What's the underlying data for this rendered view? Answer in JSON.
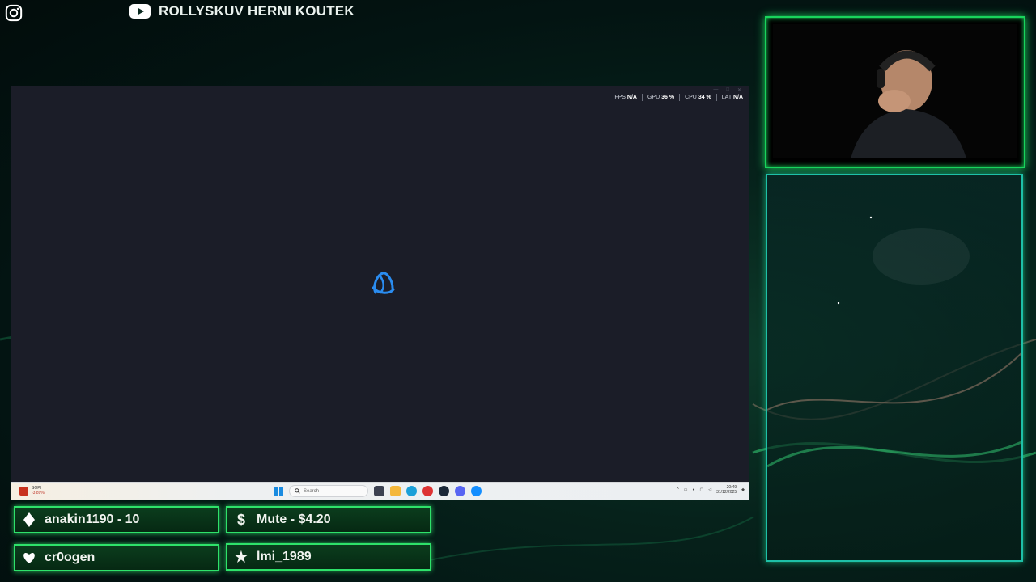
{
  "channel": {
    "name": "ROLLYSKUV HERNI KOUTEK",
    "icons": [
      "instagram-icon",
      "youtube-icon"
    ]
  },
  "game_window": {
    "stats": [
      {
        "label": "FPS",
        "value": "N/A"
      },
      {
        "label": "GPU",
        "value": "36 %"
      },
      {
        "label": "CPU",
        "value": "34 %"
      },
      {
        "label": "LAT",
        "value": "N/A"
      }
    ],
    "loader_icon": "battlenet-icon"
  },
  "taskbar": {
    "weather_label": "SOPI",
    "weather_sub": "-3,89%",
    "search_placeholder": "Search",
    "clock_time": "20:49",
    "clock_date": "31/12/2025"
  },
  "alerts": [
    {
      "icon": "diamond-icon",
      "text": "anakin1190 - 10"
    },
    {
      "icon": "dollar-icon",
      "text": "Mute - $4.20"
    },
    {
      "icon": "heart-icon",
      "text": "cr0ogen"
    },
    {
      "icon": "star-icon",
      "text": "lmi_1989"
    }
  ],
  "colors": {
    "accent_green": "#2ee26a",
    "teal_border": "#1ec0a8",
    "screen_bg": "#1b1d28"
  }
}
